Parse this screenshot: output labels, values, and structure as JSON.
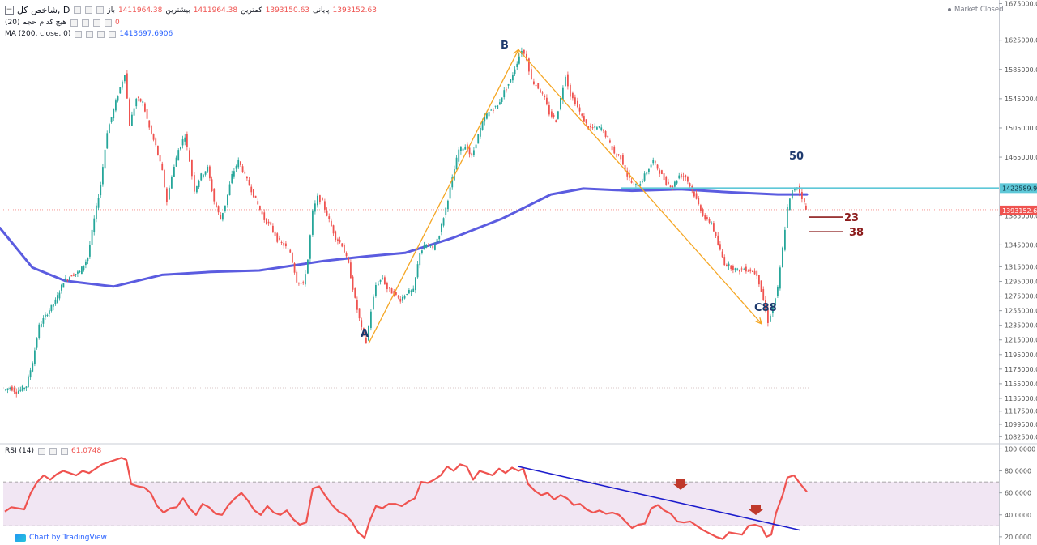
{
  "legend": {
    "symbol": "شاخص کل, D",
    "open_label": "باز",
    "open_value": "1411964.38",
    "high_label": "بیشترین",
    "high_value": "1411964.38",
    "low_label": "کمترین",
    "low_value": "1393150.63",
    "close_label": "پایانی",
    "close_value": "1393152.63",
    "volume_label": "حجم (20)",
    "volume_none": "هیچ کدام",
    "volume_value": "0",
    "ma_label": "MA (200, close, 0)",
    "ma_value": "1413697.6906",
    "rsi_label": "RSI (14)",
    "rsi_value": "61.0748"
  },
  "status": {
    "market": "Market Closed"
  },
  "credit": {
    "text": "Chart by TradingView"
  },
  "colors": {
    "up": "#26a69a",
    "down": "#ef5350",
    "ma": "#5b5ce0",
    "pattern": "#f5a623",
    "level_line": "#5ec8d8",
    "rsi_line": "#ef5350",
    "rsi_band": "#f1e6f3",
    "trendline": "#1c1ccc",
    "fib": "#8b1a1a",
    "label_text": "#1e3a6e"
  },
  "annotations": {
    "point_a": "A",
    "point_b": "B",
    "point_c": "C88",
    "level_50": "50",
    "fib_23": "23",
    "fib_38": "38"
  },
  "chart_data": [
    {
      "type": "candlestick",
      "y_axis_ticks": [
        "1675000.00",
        "1625000.00",
        "1585000.00",
        "1545000.00",
        "1505000.00",
        "1465000.00",
        "1385000.00",
        "1345000.00",
        "1315000.00",
        "1295000.00",
        "1275000.00",
        "1255000.00",
        "1235000.00",
        "1215000.00",
        "1195000.00",
        "1175000.00",
        "1155000.00",
        "1135000.00",
        "1117500.00",
        "1099500.00",
        "1082500.00"
      ],
      "ylim": [
        1074000,
        1680000
      ],
      "price_labels": {
        "level": "1422589.92",
        "last": "1393152.63"
      },
      "horizontal_level": 1422589.92,
      "last_price": 1393152.63,
      "ma_path": [
        [
          0,
          1368000
        ],
        [
          40,
          1314000
        ],
        [
          80,
          1296000
        ],
        [
          140,
          1288000
        ],
        [
          200,
          1304000
        ],
        [
          260,
          1308000
        ],
        [
          320,
          1310000
        ],
        [
          400,
          1323000
        ],
        [
          450,
          1329000
        ],
        [
          500,
          1334000
        ],
        [
          560,
          1355000
        ],
        [
          620,
          1381000
        ],
        [
          680,
          1414000
        ],
        [
          720,
          1422000
        ],
        [
          780,
          1419000
        ],
        [
          840,
          1421000
        ],
        [
          900,
          1417000
        ],
        [
          960,
          1414000
        ],
        [
          996,
          1414000
        ]
      ],
      "pattern_points": {
        "A": [
          455,
          1210000
        ],
        "B": [
          640,
          1612000
        ],
        "C": [
          940,
          1237000
        ]
      },
      "fib_levels": {
        "23": 1383000,
        "38": 1363000
      },
      "close_path": [
        [
          6,
          1146000
        ],
        [
          14,
          1150000
        ],
        [
          22,
          1144000
        ],
        [
          34,
          1152000
        ],
        [
          42,
          1185000
        ],
        [
          50,
          1234000
        ],
        [
          60,
          1252000
        ],
        [
          70,
          1268000
        ],
        [
          80,
          1295000
        ],
        [
          90,
          1304000
        ],
        [
          100,
          1308000
        ],
        [
          110,
          1328000
        ],
        [
          118,
          1380000
        ],
        [
          126,
          1428000
        ],
        [
          134,
          1500000
        ],
        [
          142,
          1530000
        ],
        [
          150,
          1560000
        ],
        [
          156,
          1580000
        ],
        [
          162,
          1510000
        ],
        [
          170,
          1545000
        ],
        [
          178,
          1540000
        ],
        [
          186,
          1505000
        ],
        [
          194,
          1480000
        ],
        [
          202,
          1445000
        ],
        [
          208,
          1405000
        ],
        [
          214,
          1440000
        ],
        [
          222,
          1475000
        ],
        [
          230,
          1495000
        ],
        [
          236,
          1460000
        ],
        [
          242,
          1420000
        ],
        [
          250,
          1440000
        ],
        [
          258,
          1450000
        ],
        [
          266,
          1405000
        ],
        [
          274,
          1380000
        ],
        [
          280,
          1400000
        ],
        [
          288,
          1440000
        ],
        [
          296,
          1460000
        ],
        [
          304,
          1440000
        ],
        [
          312,
          1420000
        ],
        [
          320,
          1400000
        ],
        [
          328,
          1380000
        ],
        [
          336,
          1370000
        ],
        [
          344,
          1352000
        ],
        [
          352,
          1345000
        ],
        [
          360,
          1335000
        ],
        [
          368,
          1296000
        ],
        [
          376,
          1290000
        ],
        [
          382,
          1325000
        ],
        [
          388,
          1390000
        ],
        [
          394,
          1410000
        ],
        [
          400,
          1403000
        ],
        [
          408,
          1378000
        ],
        [
          416,
          1355000
        ],
        [
          424,
          1345000
        ],
        [
          432,
          1318000
        ],
        [
          440,
          1270000
        ],
        [
          448,
          1230000
        ],
        [
          454,
          1212000
        ],
        [
          460,
          1255000
        ],
        [
          466,
          1290000
        ],
        [
          474,
          1300000
        ],
        [
          480,
          1285000
        ],
        [
          488,
          1278000
        ],
        [
          496,
          1270000
        ],
        [
          504,
          1280000
        ],
        [
          512,
          1282000
        ],
        [
          520,
          1335000
        ],
        [
          528,
          1345000
        ],
        [
          536,
          1340000
        ],
        [
          544,
          1360000
        ],
        [
          552,
          1395000
        ],
        [
          560,
          1435000
        ],
        [
          568,
          1475000
        ],
        [
          576,
          1480000
        ],
        [
          584,
          1465000
        ],
        [
          592,
          1495000
        ],
        [
          600,
          1520000
        ],
        [
          608,
          1530000
        ],
        [
          616,
          1535000
        ],
        [
          624,
          1555000
        ],
        [
          632,
          1570000
        ],
        [
          640,
          1595000
        ],
        [
          646,
          1612000
        ],
        [
          652,
          1600000
        ],
        [
          658,
          1570000
        ],
        [
          666,
          1560000
        ],
        [
          674,
          1545000
        ],
        [
          680,
          1525000
        ],
        [
          688,
          1515000
        ],
        [
          694,
          1545000
        ],
        [
          700,
          1578000
        ],
        [
          706,
          1550000
        ],
        [
          712,
          1540000
        ],
        [
          720,
          1520000
        ],
        [
          728,
          1505000
        ],
        [
          736,
          1505000
        ],
        [
          744,
          1505000
        ],
        [
          752,
          1490000
        ],
        [
          760,
          1470000
        ],
        [
          768,
          1465000
        ],
        [
          776,
          1440000
        ],
        [
          784,
          1425000
        ],
        [
          792,
          1430000
        ],
        [
          800,
          1445000
        ],
        [
          808,
          1460000
        ],
        [
          816,
          1445000
        ],
        [
          824,
          1430000
        ],
        [
          832,
          1425000
        ],
        [
          840,
          1440000
        ],
        [
          848,
          1438000
        ],
        [
          856,
          1420000
        ],
        [
          864,
          1400000
        ],
        [
          872,
          1380000
        ],
        [
          880,
          1375000
        ],
        [
          888,
          1345000
        ],
        [
          896,
          1320000
        ],
        [
          904,
          1315000
        ],
        [
          912,
          1310000
        ],
        [
          920,
          1312000
        ],
        [
          928,
          1310000
        ],
        [
          936,
          1305000
        ],
        [
          944,
          1270000
        ],
        [
          950,
          1240000
        ],
        [
          956,
          1260000
        ],
        [
          962,
          1285000
        ],
        [
          968,
          1340000
        ],
        [
          974,
          1395000
        ],
        [
          980,
          1418000
        ],
        [
          986,
          1425000
        ],
        [
          992,
          1410000
        ],
        [
          996,
          1393000
        ]
      ]
    },
    {
      "type": "line",
      "name": "RSI (14)",
      "y_axis_ticks": [
        "100.0000",
        "80.0000",
        "60.0000",
        "40.0000",
        "20.0000"
      ],
      "ylim": [
        14,
        104
      ],
      "band": [
        30,
        70
      ],
      "values": [
        [
          6,
          43
        ],
        [
          14,
          47
        ],
        [
          22,
          46
        ],
        [
          30,
          45
        ],
        [
          38,
          60
        ],
        [
          46,
          70
        ],
        [
          54,
          76
        ],
        [
          62,
          72
        ],
        [
          70,
          77
        ],
        [
          78,
          80
        ],
        [
          86,
          78
        ],
        [
          94,
          76
        ],
        [
          102,
          80
        ],
        [
          110,
          78
        ],
        [
          118,
          82
        ],
        [
          126,
          86
        ],
        [
          134,
          88
        ],
        [
          142,
          90
        ],
        [
          150,
          92
        ],
        [
          156,
          90
        ],
        [
          162,
          68
        ],
        [
          170,
          66
        ],
        [
          178,
          65
        ],
        [
          186,
          60
        ],
        [
          194,
          48
        ],
        [
          202,
          42
        ],
        [
          210,
          46
        ],
        [
          218,
          47
        ],
        [
          226,
          55
        ],
        [
          234,
          46
        ],
        [
          242,
          40
        ],
        [
          250,
          50
        ],
        [
          258,
          47
        ],
        [
          266,
          41
        ],
        [
          274,
          40
        ],
        [
          282,
          49
        ],
        [
          290,
          55
        ],
        [
          298,
          60
        ],
        [
          306,
          53
        ],
        [
          314,
          44
        ],
        [
          322,
          40
        ],
        [
          330,
          48
        ],
        [
          338,
          42
        ],
        [
          346,
          40
        ],
        [
          354,
          44
        ],
        [
          362,
          36
        ],
        [
          370,
          31
        ],
        [
          378,
          33
        ],
        [
          386,
          64
        ],
        [
          394,
          66
        ],
        [
          402,
          57
        ],
        [
          410,
          49
        ],
        [
          418,
          43
        ],
        [
          426,
          40
        ],
        [
          434,
          34
        ],
        [
          442,
          24
        ],
        [
          450,
          19
        ],
        [
          456,
          34
        ],
        [
          464,
          48
        ],
        [
          472,
          46
        ],
        [
          480,
          50
        ],
        [
          488,
          50
        ],
        [
          496,
          48
        ],
        [
          504,
          52
        ],
        [
          512,
          55
        ],
        [
          520,
          70
        ],
        [
          528,
          69
        ],
        [
          536,
          72
        ],
        [
          544,
          76
        ],
        [
          552,
          84
        ],
        [
          560,
          80
        ],
        [
          568,
          86
        ],
        [
          576,
          84
        ],
        [
          584,
          72
        ],
        [
          592,
          80
        ],
        [
          600,
          78
        ],
        [
          608,
          76
        ],
        [
          616,
          82
        ],
        [
          624,
          78
        ],
        [
          632,
          83
        ],
        [
          640,
          80
        ],
        [
          646,
          82
        ],
        [
          652,
          68
        ],
        [
          660,
          62
        ],
        [
          668,
          58
        ],
        [
          676,
          60
        ],
        [
          684,
          54
        ],
        [
          692,
          58
        ],
        [
          700,
          55
        ],
        [
          708,
          49
        ],
        [
          716,
          50
        ],
        [
          724,
          45
        ],
        [
          732,
          42
        ],
        [
          740,
          44
        ],
        [
          748,
          41
        ],
        [
          756,
          42
        ],
        [
          764,
          40
        ],
        [
          772,
          34
        ],
        [
          780,
          28
        ],
        [
          788,
          31
        ],
        [
          796,
          32
        ],
        [
          804,
          46
        ],
        [
          812,
          49
        ],
        [
          820,
          44
        ],
        [
          828,
          41
        ],
        [
          836,
          34
        ],
        [
          844,
          33
        ],
        [
          852,
          34
        ],
        [
          860,
          30
        ],
        [
          868,
          26
        ],
        [
          876,
          23
        ],
        [
          884,
          20
        ],
        [
          892,
          18
        ],
        [
          900,
          24
        ],
        [
          908,
          23
        ],
        [
          916,
          22
        ],
        [
          924,
          30
        ],
        [
          932,
          31
        ],
        [
          940,
          29
        ],
        [
          946,
          20
        ],
        [
          952,
          22
        ],
        [
          958,
          42
        ],
        [
          966,
          58
        ],
        [
          972,
          74
        ],
        [
          980,
          76
        ],
        [
          988,
          68
        ],
        [
          996,
          61
        ]
      ],
      "trendline": [
        [
          640,
          84
        ],
        [
          988,
          26
        ]
      ],
      "arrows": [
        [
          840,
          65
        ],
        [
          933,
          42
        ]
      ]
    }
  ]
}
